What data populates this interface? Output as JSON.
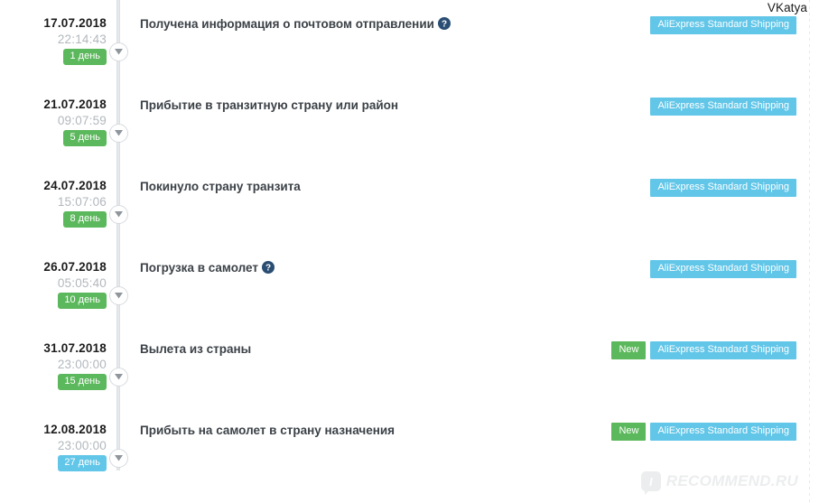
{
  "header": {
    "username": "VKatya"
  },
  "watermark": {
    "logo_letter": "I",
    "text": "RECOMMEND.RU"
  },
  "colors": {
    "badge_green": "#5cb85c",
    "badge_blue": "#62c6e8",
    "tag_new_green": "#5cb85c",
    "tag_shipping_blue": "#62c6e8",
    "rail_gray": "#e6e9ec",
    "date_text": "#1c1c1c",
    "time_text": "#b2b8bd",
    "title_text": "#3b4147",
    "help_icon": "#2a4d73"
  },
  "timeline": {
    "events": [
      {
        "date": "17.07.2018",
        "time": "22:14:43",
        "day_badge": "1 день",
        "day_badge_color": "#5cb85c",
        "title": "Получена информация о почтовом отправлении",
        "has_help_icon": true,
        "tags": [
          "AliExpress Standard Shipping"
        ],
        "has_new_tag": false,
        "new_tag_label": "New"
      },
      {
        "date": "21.07.2018",
        "time": "09:07:59",
        "day_badge": "5 день",
        "day_badge_color": "#5cb85c",
        "title": "Прибытие в транзитную страну или район",
        "has_help_icon": false,
        "tags": [
          "AliExpress Standard Shipping"
        ],
        "has_new_tag": false,
        "new_tag_label": "New"
      },
      {
        "date": "24.07.2018",
        "time": "15:07:06",
        "day_badge": "8 день",
        "day_badge_color": "#5cb85c",
        "title": "Покинуло страну транзита",
        "has_help_icon": false,
        "tags": [
          "AliExpress Standard Shipping"
        ],
        "has_new_tag": false,
        "new_tag_label": "New"
      },
      {
        "date": "26.07.2018",
        "time": "05:05:40",
        "day_badge": "10 день",
        "day_badge_color": "#5cb85c",
        "title": "Погрузка в самолет",
        "has_help_icon": true,
        "tags": [
          "AliExpress Standard Shipping"
        ],
        "has_new_tag": false,
        "new_tag_label": "New"
      },
      {
        "date": "31.07.2018",
        "time": "23:00:00",
        "day_badge": "15 день",
        "day_badge_color": "#5cb85c",
        "title": "Вылета из страны",
        "has_help_icon": false,
        "tags": [
          "AliExpress Standard Shipping"
        ],
        "has_new_tag": true,
        "new_tag_label": "New"
      },
      {
        "date": "12.08.2018",
        "time": "23:00:00",
        "day_badge": "27 день",
        "day_badge_color": "#62c6e8",
        "title": "Прибыть на самолет в страну назначения",
        "has_help_icon": false,
        "tags": [
          "AliExpress Standard Shipping"
        ],
        "has_new_tag": true,
        "new_tag_label": "New"
      }
    ]
  }
}
